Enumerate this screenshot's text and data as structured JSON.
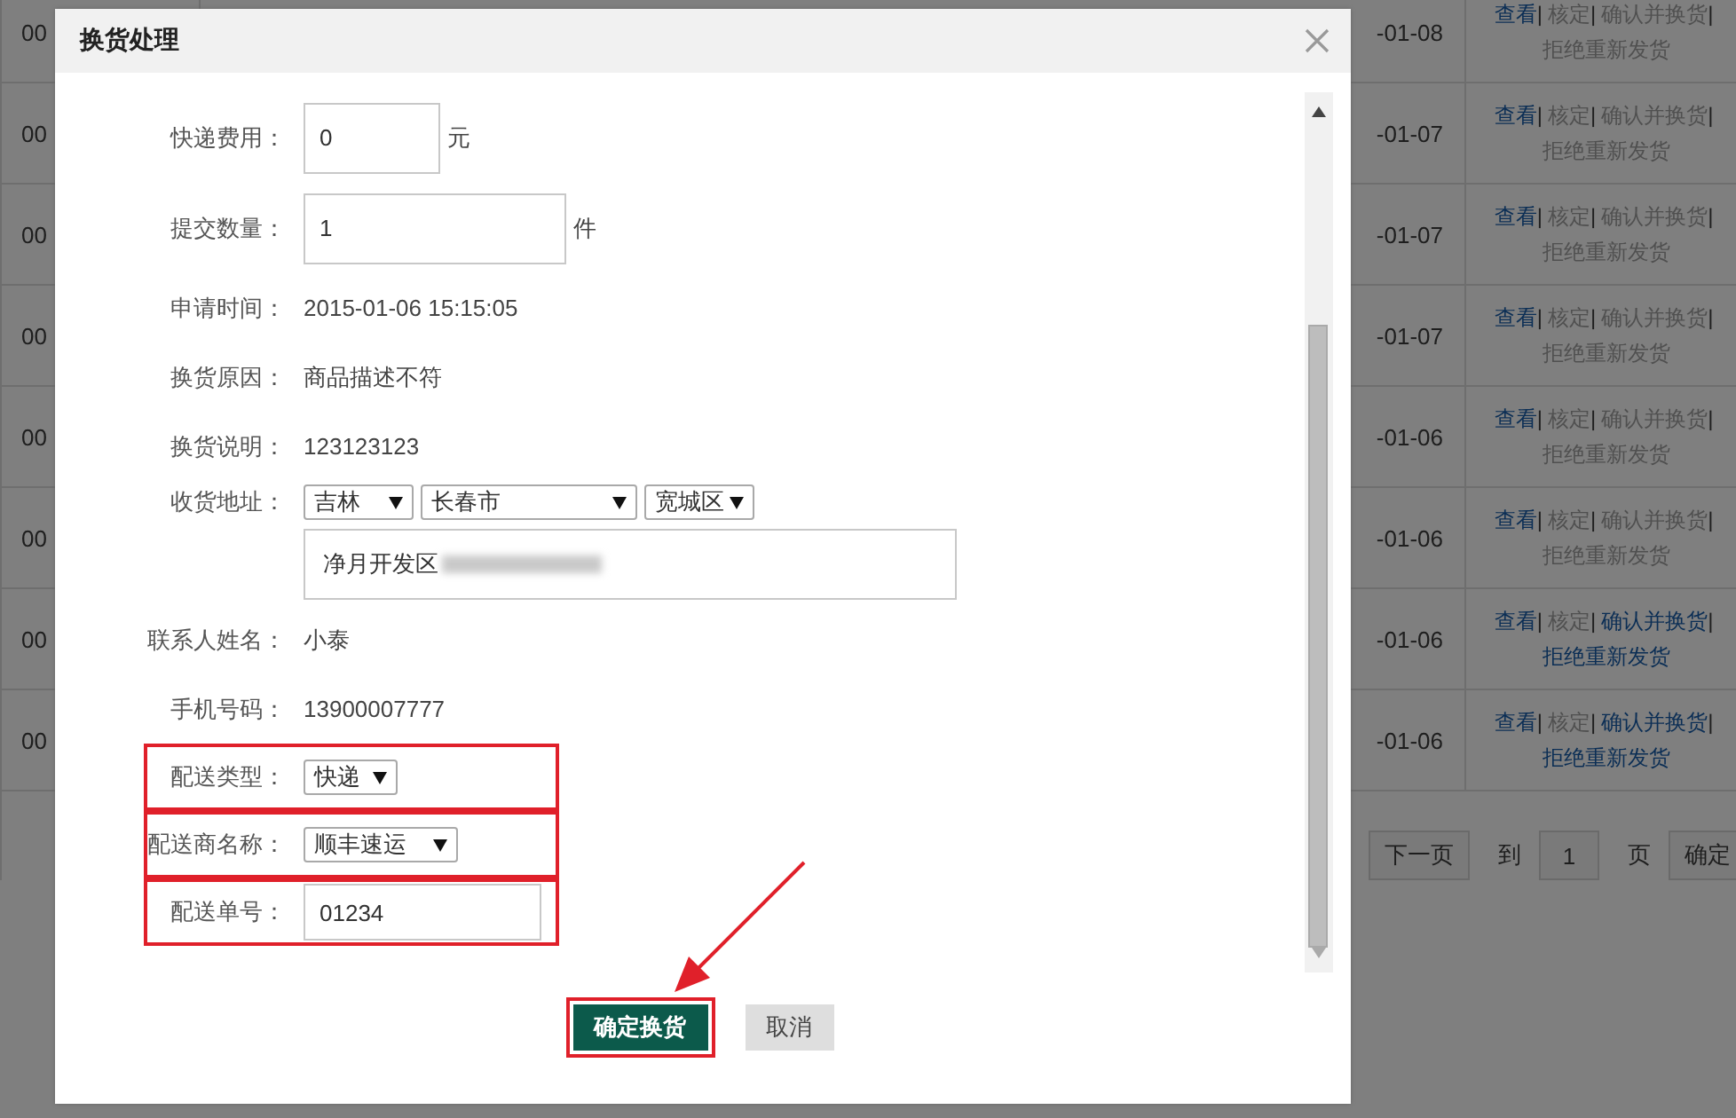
{
  "background_table": {
    "rows": [
      {
        "column_1": "00",
        "date": "-01-08",
        "actions": [
          {
            "label": "查看",
            "disabled": false,
            "separator": "|"
          },
          {
            "label": "核定",
            "disabled": true,
            "separator": "|"
          },
          {
            "label": "确认并换货",
            "disabled": true,
            "separator": "|"
          },
          {
            "label": "拒绝重新发货",
            "disabled": true
          }
        ]
      },
      {
        "column_1": "00",
        "date": "-01-07",
        "actions": [
          {
            "label": "查看",
            "disabled": false,
            "separator": "|"
          },
          {
            "label": "核定",
            "disabled": true,
            "separator": "|"
          },
          {
            "label": "确认并换货",
            "disabled": true,
            "separator": "|"
          },
          {
            "label": "拒绝重新发货",
            "disabled": true
          }
        ]
      },
      {
        "column_1": "00",
        "date": "-01-07",
        "actions": [
          {
            "label": "查看",
            "disabled": false,
            "separator": "|"
          },
          {
            "label": "核定",
            "disabled": true,
            "separator": "|"
          },
          {
            "label": "确认并换货",
            "disabled": true,
            "separator": "|"
          },
          {
            "label": "拒绝重新发货",
            "disabled": true
          }
        ]
      },
      {
        "column_1": "00",
        "date": "-01-07",
        "actions": [
          {
            "label": "查看",
            "disabled": false,
            "separator": "|"
          },
          {
            "label": "核定",
            "disabled": true,
            "separator": "|"
          },
          {
            "label": "确认并换货",
            "disabled": true,
            "separator": "|"
          },
          {
            "label": "拒绝重新发货",
            "disabled": true
          }
        ]
      },
      {
        "column_1": "00",
        "date": "-01-06",
        "actions": [
          {
            "label": "查看",
            "disabled": false,
            "separator": "|"
          },
          {
            "label": "核定",
            "disabled": true,
            "separator": "|"
          },
          {
            "label": "确认并换货",
            "disabled": true,
            "separator": "|"
          },
          {
            "label": "拒绝重新发货",
            "disabled": true
          }
        ]
      },
      {
        "column_1": "00",
        "date": "-01-06",
        "actions": [
          {
            "label": "查看",
            "disabled": false,
            "separator": "|"
          },
          {
            "label": "核定",
            "disabled": true,
            "separator": "|"
          },
          {
            "label": "确认并换货",
            "disabled": true,
            "separator": "|"
          },
          {
            "label": "拒绝重新发货",
            "disabled": true
          }
        ]
      },
      {
        "column_1": "00",
        "date": "-01-06",
        "actions": [
          {
            "label": "查看",
            "disabled": false,
            "separator": "|"
          },
          {
            "label": "核定",
            "disabled": true,
            "separator": "|"
          },
          {
            "label": "确认并换货",
            "disabled": false,
            "separator": "|"
          },
          {
            "label": "拒绝重新发货",
            "disabled": false
          }
        ]
      },
      {
        "column_1": "00",
        "date": "-01-06",
        "actions": [
          {
            "label": "查看",
            "disabled": false,
            "separator": "|"
          },
          {
            "label": "核定",
            "disabled": true,
            "separator": "|"
          },
          {
            "label": "确认并换货",
            "disabled": false,
            "separator": "|"
          },
          {
            "label": "拒绝重新发货",
            "disabled": false
          }
        ]
      }
    ]
  },
  "pagination": {
    "next_button": "下一页",
    "goto_label": "到",
    "page_input": "1",
    "page_unit": "页",
    "go_button": "确定"
  },
  "dialog": {
    "title": "换货处理",
    "fields": [
      {
        "kind": "input",
        "label": "快递费用：",
        "value": "0",
        "unit": "元",
        "highlighted": false
      },
      {
        "kind": "input",
        "label": "提交数量：",
        "value": "1",
        "unit": "件",
        "highlighted": false
      },
      {
        "kind": "text",
        "label": "申请时间：",
        "value": "2015-01-06 15:15:05",
        "highlighted": false
      },
      {
        "kind": "text",
        "label": "换货原因：",
        "value": "商品描述不符",
        "highlighted": false
      },
      {
        "kind": "text",
        "label": "换货说明：",
        "value": "123123123",
        "highlighted": false
      },
      {
        "kind": "address",
        "label": "收货地址：",
        "selects": [
          "吉林",
          "长春市",
          "宽城区"
        ],
        "detail": "净月开发区",
        "highlighted": false
      },
      {
        "kind": "text",
        "label": "联系人姓名：",
        "value": "小泰",
        "highlighted": false
      },
      {
        "kind": "text",
        "label": "手机号码：",
        "value": "13900007777",
        "highlighted": false
      },
      {
        "kind": "select",
        "label": "配送类型：",
        "value": "快递",
        "highlighted": true
      },
      {
        "kind": "select",
        "label": "配送商名称：",
        "value": "顺丰速运",
        "highlighted": true
      },
      {
        "kind": "input",
        "label": "配送单号：",
        "value": "01234",
        "highlighted": true
      }
    ],
    "buttons": [
      {
        "label": "确定换货",
        "kind": "primary",
        "highlighted": true
      },
      {
        "label": "取消",
        "kind": "secondary",
        "highlighted": false
      }
    ]
  }
}
